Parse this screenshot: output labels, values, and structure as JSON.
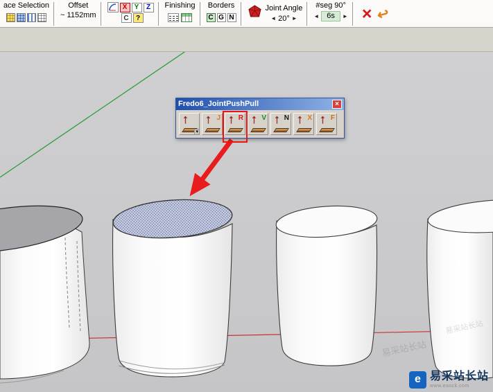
{
  "colors": {
    "annotation_red": "#e81c1c",
    "axis_green": "#2f9e3a",
    "axis_red": "#c83030",
    "selection_face_fill": "#c9cedf",
    "selection_dot": "#51619e",
    "titlebar_blue_left": "#1f4fae",
    "titlebar_blue_right": "#8fb3e6",
    "watermark_blue": "#1565c0"
  },
  "toolbar": {
    "face_selection": {
      "label": "ace Selection"
    },
    "offset": {
      "label": "Offset",
      "value": "~ 1152mm"
    },
    "axis_lock": {
      "x": "X",
      "y": "Y",
      "z": "Z",
      "custom": "C",
      "help": "?"
    },
    "finishing": {
      "label": "Finishing"
    },
    "borders": {
      "label": "Borders",
      "c": "C",
      "g": "G",
      "n": "N"
    },
    "joint_angle": {
      "label": "Joint Angle",
      "value": "20°"
    },
    "segments": {
      "label": "#seg 90°",
      "value": "6s"
    }
  },
  "icons": {
    "spinner_left": "◄",
    "spinner_right": "►",
    "abort": "×",
    "undo": "↩",
    "close": "×",
    "dropdown": "▾",
    "push_arrow": "↑"
  },
  "dialog": {
    "title": "Fredo6_JointPushPull",
    "buttons": [
      "",
      "J",
      "R",
      "V",
      "N",
      "X",
      "F"
    ]
  },
  "watermark": {
    "site_name": "易采站长站",
    "site_url": "www.easck.com",
    "logo_glyph": "e",
    "faint_text": "易采站长站"
  }
}
